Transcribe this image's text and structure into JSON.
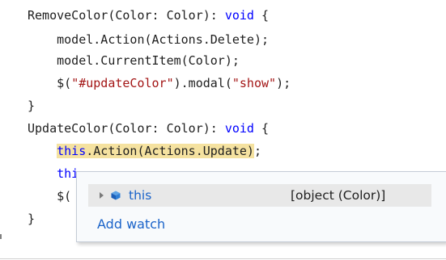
{
  "code": {
    "line1": {
      "fn": "RemoveColor(Color: Color): ",
      "kw": "void",
      "end": " {"
    },
    "line2": "    model.Action(Actions.Delete);",
    "line3": "    model.CurrentItem(Color);",
    "line4": {
      "a": "    $(",
      "s1": "\"#updateColor\"",
      "b": ").modal(",
      "s2": "\"show\"",
      "c": ");"
    },
    "line5": "}",
    "line6": {
      "fn": "UpdateColor(Color: Color): ",
      "kw": "void",
      "end": " {"
    },
    "line7": {
      "indent": "    ",
      "kw": "this",
      "rest": ".Action(Actions.Update)",
      "end": ";"
    },
    "line8": {
      "indent": "    ",
      "partial": "thi"
    },
    "line9": {
      "indent": "    ",
      "partial": "$("
    },
    "line10": "}"
  },
  "datatip": {
    "expand_icon": "triangle-right-icon",
    "object_icon": "object-cube-icon",
    "name": "this",
    "value": "[object (Color)]",
    "add_watch": "Add watch",
    "colors": {
      "name": "#1a63c9",
      "link": "#1a63c9",
      "row_bg": "#e8e8e8",
      "highlight": "#f5e2a0"
    }
  }
}
